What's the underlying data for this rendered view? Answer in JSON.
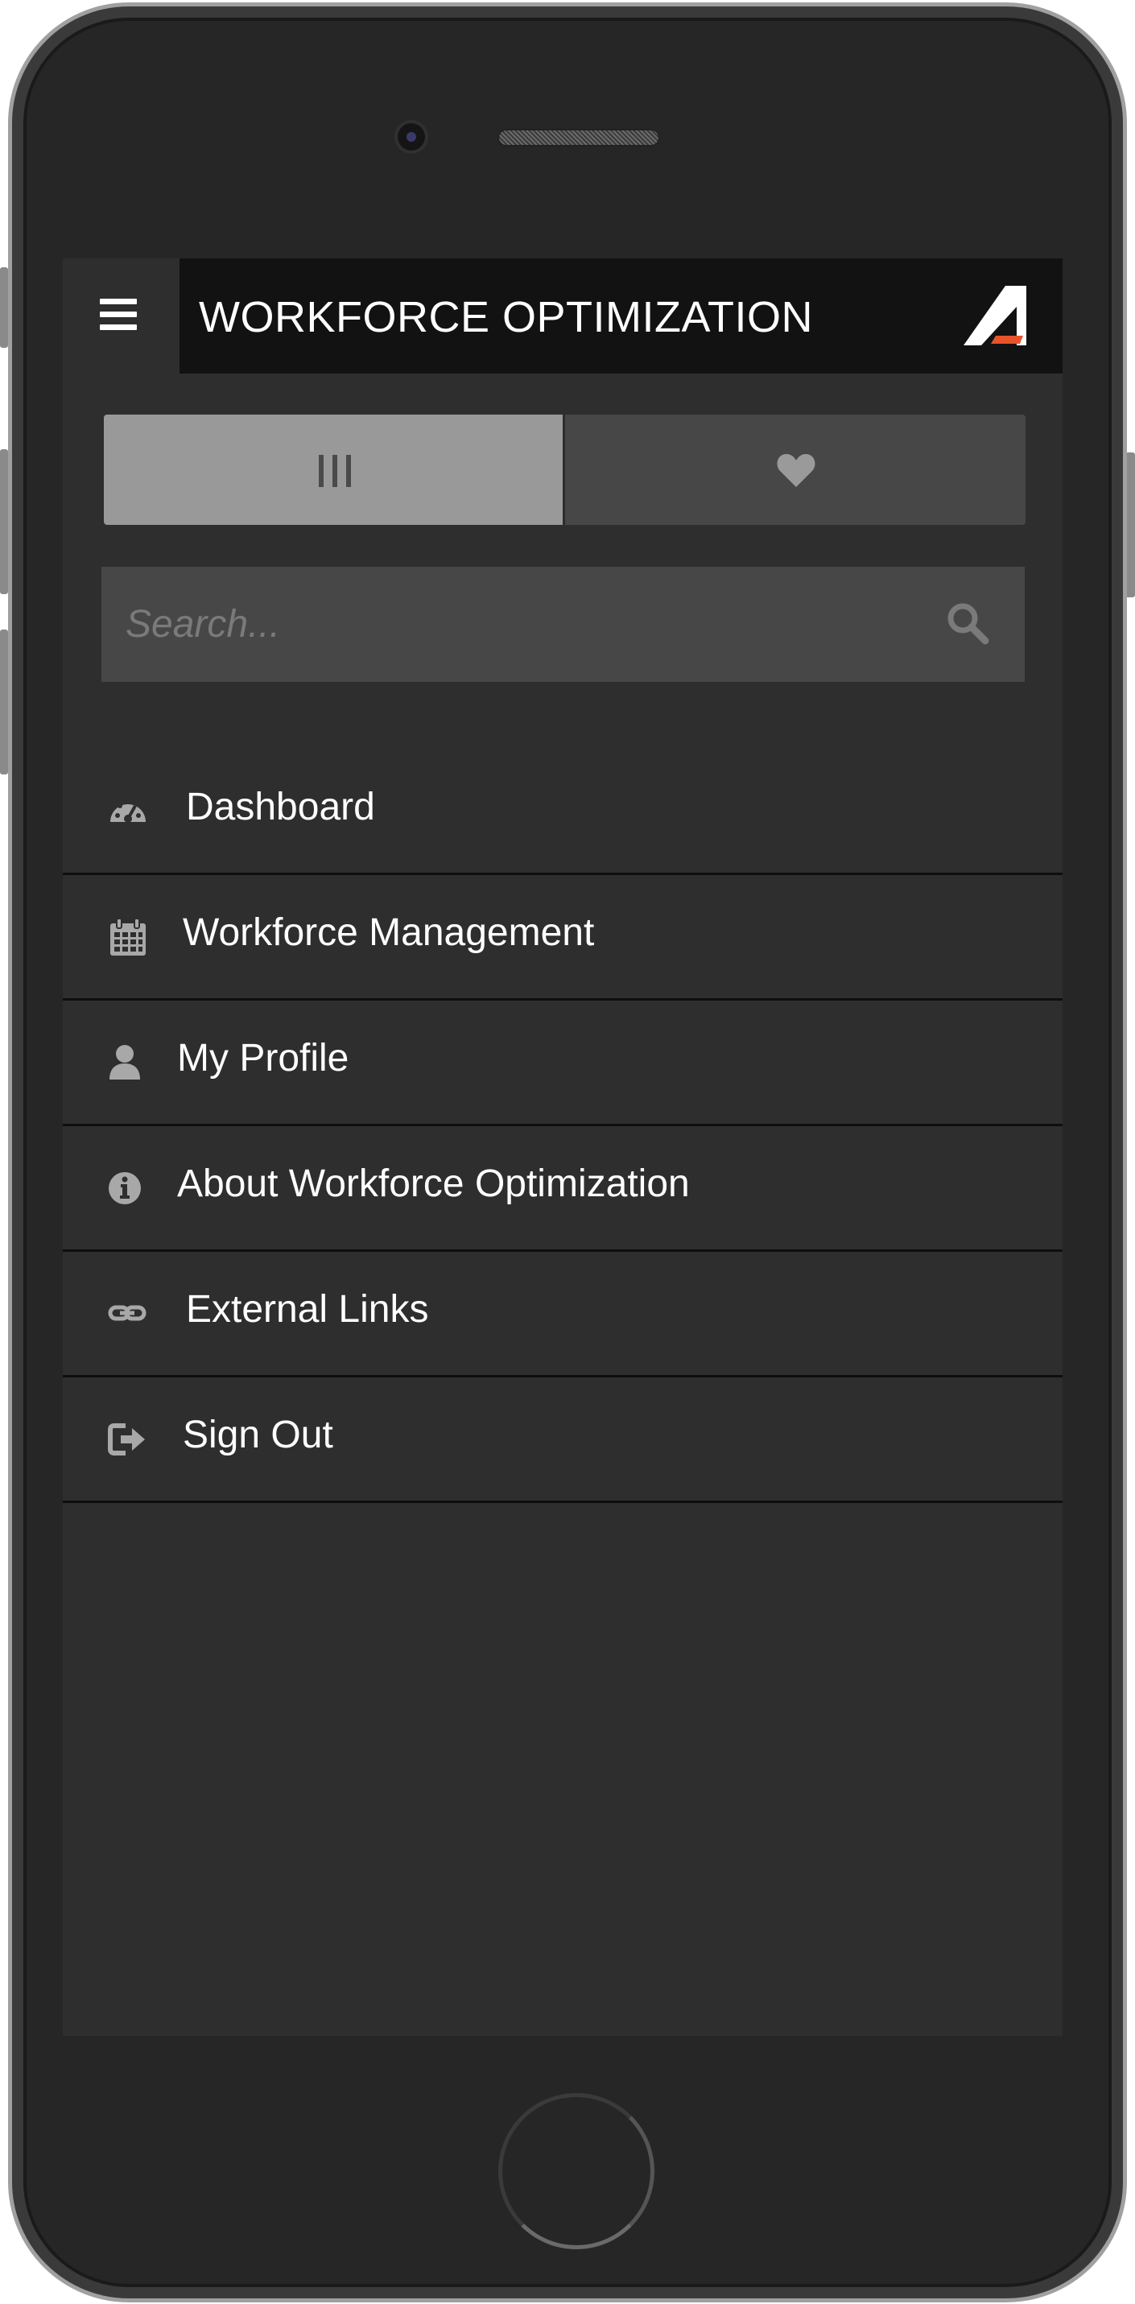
{
  "header": {
    "menu_icon": "hamburger-icon",
    "title": "WORKFORCE OPTIMIZATION",
    "logo": "brand-logo",
    "logo_accent_color": "#e8532a"
  },
  "view_toggle": {
    "left_icon": "columns-icon",
    "right_icon": "heart-icon",
    "active": "left"
  },
  "search": {
    "placeholder": "Search...",
    "value": "",
    "icon": "search-icon"
  },
  "menu": {
    "items": [
      {
        "label": "Dashboard",
        "icon": "dashboard-icon"
      },
      {
        "label": "Workforce Management",
        "icon": "calendar-icon"
      },
      {
        "label": "My Profile",
        "icon": "user-icon"
      },
      {
        "label": "About Workforce Optimization",
        "icon": "info-icon"
      },
      {
        "label": "External Links",
        "icon": "link-icon"
      },
      {
        "label": "Sign Out",
        "icon": "sign-out-icon"
      }
    ]
  }
}
